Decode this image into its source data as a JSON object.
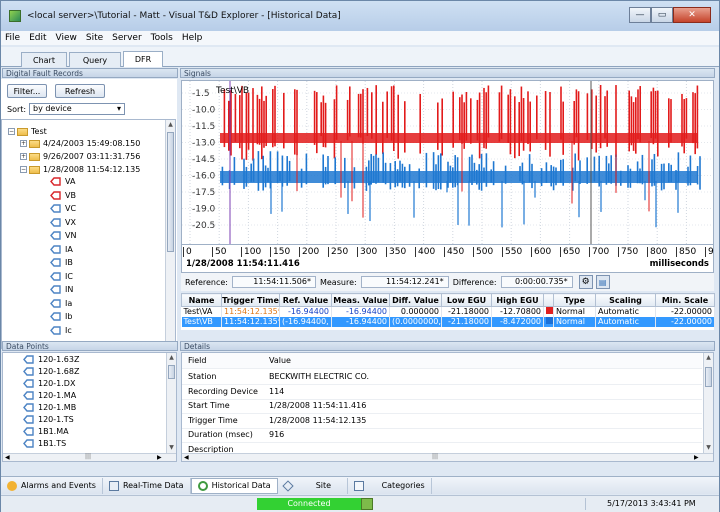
{
  "window": {
    "title": "<local server>\\Tutorial - Matt - Visual T&D Explorer - [Historical Data]",
    "minimize": "—",
    "maximize": "▭",
    "close": "✕"
  },
  "menu": [
    "File",
    "Edit",
    "View",
    "Site",
    "Server",
    "Tools",
    "Help"
  ],
  "tabs": [
    "Chart",
    "Query",
    "DFR"
  ],
  "active_tab": "DFR",
  "dfr_panel": {
    "title": "Digital Fault Records",
    "filter_label": "Filter...",
    "refresh_label": "Refresh",
    "sort_label": "Sort:",
    "sort_value": "by device"
  },
  "tree": {
    "root": "Test",
    "records": [
      "4/24/2003 15:49:08.150",
      "9/26/2007 03:11:31.756",
      "1/28/2008 11:54:12.135"
    ],
    "signals": [
      "VA",
      "VB",
      "VC",
      "VX",
      "VN",
      "IA",
      "IB",
      "IC",
      "IN",
      "Ia",
      "Ib",
      "Ic"
    ]
  },
  "data_points": {
    "title": "Data Points",
    "items": [
      "120-1.63Z",
      "120-1.68Z",
      "120-1.DX",
      "120-1.MA",
      "120-1.MB",
      "120-1.TS",
      "1B1.MA",
      "1B1.TS"
    ]
  },
  "signals_panel": {
    "title": "Signals",
    "trace_label": "Test\\VB",
    "y_ticks": [
      "-1.5",
      "-10.0",
      "-11.5",
      "-13.0",
      "-14.5",
      "-16.0",
      "-17.5",
      "-19.0",
      "-20.5"
    ],
    "x_ticks": [
      "0",
      "50",
      "100",
      "150",
      "200",
      "250",
      "300",
      "350",
      "400",
      "450",
      "500",
      "550",
      "600",
      "650",
      "700",
      "750",
      "800",
      "850",
      "9"
    ],
    "start_time": "1/28/2008 11:54:11.416",
    "unit": "milliseconds"
  },
  "info": {
    "reference_label": "Reference:",
    "reference_value": "11:54:11.506*",
    "measure_label": "Measure:",
    "measure_value": "11:54:12.241*",
    "difference_label": "Difference:",
    "difference_value": "0:00:00.735*"
  },
  "signal_table": {
    "columns": [
      "Name",
      "Trigger Time",
      "Ref. Value",
      "Meas. Value",
      "Diff. Value",
      "Low EGU",
      "High EGU",
      "",
      "Type",
      "Scaling",
      "Min. Scale"
    ],
    "rows": [
      [
        "Test\\VA",
        "11:54:12.135*",
        "-16.94400",
        "-16.94400",
        "0.000000",
        "-21.18000",
        "-12.70800",
        "",
        "Normal",
        "Automatic",
        "-22.00000"
      ],
      [
        "Test\\VB",
        "11:54:12.135*",
        "(-16.94400, -",
        "-16.94400",
        "(0.0000000,",
        "-21.18000",
        "-8.472000",
        "",
        "Normal",
        "Automatic",
        "-22.00000"
      ]
    ],
    "row_colors": [
      "#e02020",
      "#1a6fd6"
    ]
  },
  "details": {
    "title": "Details",
    "field_header": "Field",
    "value_header": "Value",
    "rows": [
      [
        "Station",
        "BECKWITH ELECTRIC CO."
      ],
      [
        "Recording Device",
        "114"
      ],
      [
        "Start Time",
        "1/28/2008 11:54:11.416"
      ],
      [
        "Trigger Time",
        "1/28/2008 11:54:12.135"
      ],
      [
        "Duration (msec)",
        "916"
      ],
      [
        "Description",
        ""
      ]
    ]
  },
  "bottom_tabs": [
    "Alarms and Events",
    "Real-Time Data",
    "Historical Data",
    "Site",
    "Categories"
  ],
  "active_bottom_tab": "Historical Data",
  "status": {
    "connection": "Connected",
    "datetime": "5/17/2013 3:43:41 PM",
    "connected_color": "#33d133"
  }
}
